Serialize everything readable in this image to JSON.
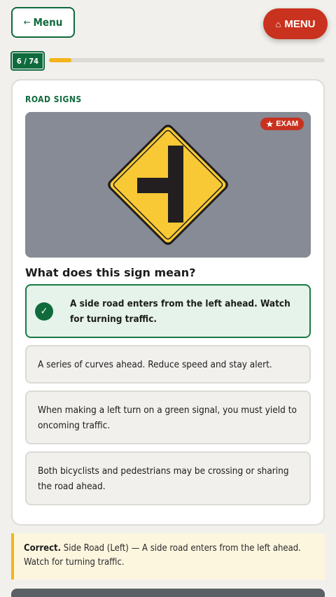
{
  "header": {
    "back_label": "Menu",
    "back_arrow": "←",
    "menu_label": "MENU",
    "menu_icon": "⌂"
  },
  "progress": {
    "counter": "6 / 74",
    "current": 6,
    "total": 74,
    "fraction": 0.081
  },
  "question_card": {
    "category": "ROAD SIGNS",
    "badge": "EXAM",
    "badge_icon": "★",
    "sign_icon": "side-road-left-warning-sign",
    "question": "What does this sign mean?",
    "options": [
      {
        "text": "A side road enters from the left ahead. Watch for turning traffic.",
        "state": "correct"
      },
      {
        "text": "A series of curves ahead. Reduce speed and stay alert.",
        "state": "default"
      },
      {
        "text": "When making a left turn on a green signal, you must yield to oncoming traffic.",
        "state": "default"
      },
      {
        "text": "Both bicyclists and pedestrians may be crossing or sharing the road ahead.",
        "state": "default"
      }
    ]
  },
  "feedback": {
    "lead": "Correct.",
    "text": "Side Road (Left) — A side road enters from the left ahead. Watch for turning traffic."
  },
  "colors": {
    "brand_green": "#0f6a3c",
    "accent_red": "#c8321e",
    "progress_yellow": "#f4b41a",
    "sign_yellow": "#f8c935"
  }
}
